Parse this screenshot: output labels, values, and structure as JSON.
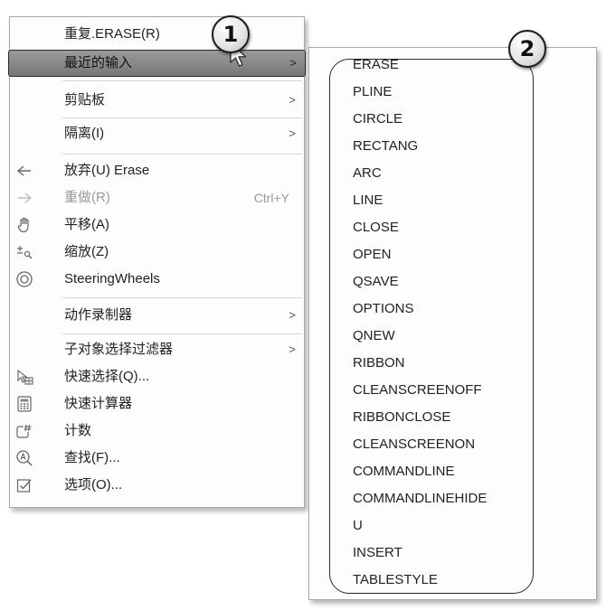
{
  "context_menu": {
    "items": [
      {
        "label": "重复.ERASE(R)"
      },
      {
        "label": "最近的输入"
      },
      {
        "label": "剪贴板"
      },
      {
        "label": "隔离(I)"
      },
      {
        "label": "放弃(U) Erase",
        "icon": "undo-icon"
      },
      {
        "label": "重做(R)",
        "shortcut": "Ctrl+Y",
        "icon": "redo-icon"
      },
      {
        "label": "平移(A)",
        "icon": "pan-hand-icon"
      },
      {
        "label": "缩放(Z)",
        "icon": "zoom-icon"
      },
      {
        "label": "SteeringWheels",
        "icon": "steering-wheel-icon"
      },
      {
        "label": "动作录制器"
      },
      {
        "label": "子对象选择过滤器"
      },
      {
        "label": "快速选择(Q)...",
        "icon": "quick-select-icon"
      },
      {
        "label": "快速计算器",
        "icon": "calculator-icon"
      },
      {
        "label": "计数",
        "icon": "count-icon"
      },
      {
        "label": "查找(F)...",
        "icon": "find-icon"
      },
      {
        "label": "选项(O)...",
        "icon": "options-icon"
      }
    ],
    "submenu_arrow": ">"
  },
  "recent_input_submenu": {
    "items": [
      "ERASE",
      "PLINE",
      "CIRCLE",
      "RECTANG",
      "ARC",
      "LINE",
      "CLOSE",
      "OPEN",
      "QSAVE",
      "OPTIONS",
      "QNEW",
      "RIBBON",
      "CLEANSCREENOFF",
      "RIBBONCLOSE",
      "CLEANSCREENON",
      "COMMANDLINE",
      "COMMANDLINEHIDE",
      "U",
      "INSERT",
      "TABLESTYLE"
    ]
  },
  "callouts": {
    "first": "1",
    "second": "2"
  },
  "colors": {
    "highlight": "#878787",
    "border": "#a9a9a9",
    "text": "#222222"
  }
}
